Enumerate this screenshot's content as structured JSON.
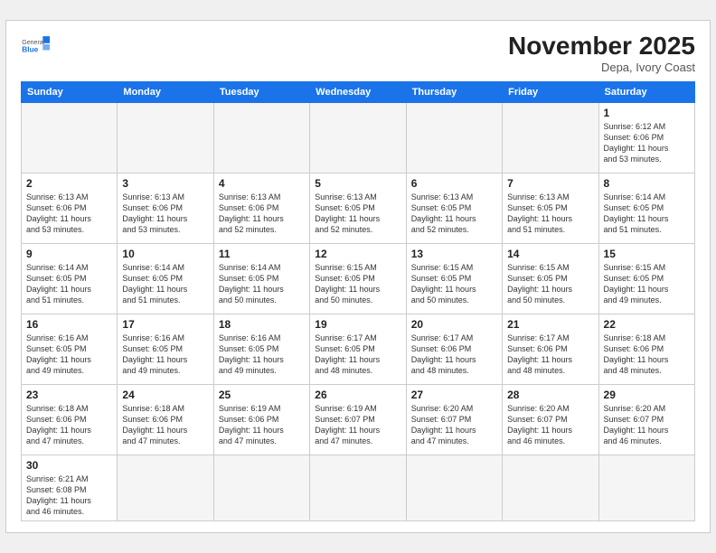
{
  "header": {
    "logo_general": "General",
    "logo_blue": "Blue",
    "month_title": "November 2025",
    "subtitle": "Depa, Ivory Coast"
  },
  "weekdays": [
    "Sunday",
    "Monday",
    "Tuesday",
    "Wednesday",
    "Thursday",
    "Friday",
    "Saturday"
  ],
  "days": [
    {
      "num": "",
      "info": "",
      "empty": true
    },
    {
      "num": "",
      "info": "",
      "empty": true
    },
    {
      "num": "",
      "info": "",
      "empty": true
    },
    {
      "num": "",
      "info": "",
      "empty": true
    },
    {
      "num": "",
      "info": "",
      "empty": true
    },
    {
      "num": "",
      "info": "",
      "empty": true
    },
    {
      "num": "1",
      "info": "Sunrise: 6:12 AM\nSunset: 6:06 PM\nDaylight: 11 hours\nand 53 minutes.",
      "empty": false
    },
    {
      "num": "2",
      "info": "Sunrise: 6:13 AM\nSunset: 6:06 PM\nDaylight: 11 hours\nand 53 minutes.",
      "empty": false
    },
    {
      "num": "3",
      "info": "Sunrise: 6:13 AM\nSunset: 6:06 PM\nDaylight: 11 hours\nand 53 minutes.",
      "empty": false
    },
    {
      "num": "4",
      "info": "Sunrise: 6:13 AM\nSunset: 6:06 PM\nDaylight: 11 hours\nand 52 minutes.",
      "empty": false
    },
    {
      "num": "5",
      "info": "Sunrise: 6:13 AM\nSunset: 6:05 PM\nDaylight: 11 hours\nand 52 minutes.",
      "empty": false
    },
    {
      "num": "6",
      "info": "Sunrise: 6:13 AM\nSunset: 6:05 PM\nDaylight: 11 hours\nand 52 minutes.",
      "empty": false
    },
    {
      "num": "7",
      "info": "Sunrise: 6:13 AM\nSunset: 6:05 PM\nDaylight: 11 hours\nand 51 minutes.",
      "empty": false
    },
    {
      "num": "8",
      "info": "Sunrise: 6:14 AM\nSunset: 6:05 PM\nDaylight: 11 hours\nand 51 minutes.",
      "empty": false
    },
    {
      "num": "9",
      "info": "Sunrise: 6:14 AM\nSunset: 6:05 PM\nDaylight: 11 hours\nand 51 minutes.",
      "empty": false
    },
    {
      "num": "10",
      "info": "Sunrise: 6:14 AM\nSunset: 6:05 PM\nDaylight: 11 hours\nand 51 minutes.",
      "empty": false
    },
    {
      "num": "11",
      "info": "Sunrise: 6:14 AM\nSunset: 6:05 PM\nDaylight: 11 hours\nand 50 minutes.",
      "empty": false
    },
    {
      "num": "12",
      "info": "Sunrise: 6:15 AM\nSunset: 6:05 PM\nDaylight: 11 hours\nand 50 minutes.",
      "empty": false
    },
    {
      "num": "13",
      "info": "Sunrise: 6:15 AM\nSunset: 6:05 PM\nDaylight: 11 hours\nand 50 minutes.",
      "empty": false
    },
    {
      "num": "14",
      "info": "Sunrise: 6:15 AM\nSunset: 6:05 PM\nDaylight: 11 hours\nand 50 minutes.",
      "empty": false
    },
    {
      "num": "15",
      "info": "Sunrise: 6:15 AM\nSunset: 6:05 PM\nDaylight: 11 hours\nand 49 minutes.",
      "empty": false
    },
    {
      "num": "16",
      "info": "Sunrise: 6:16 AM\nSunset: 6:05 PM\nDaylight: 11 hours\nand 49 minutes.",
      "empty": false
    },
    {
      "num": "17",
      "info": "Sunrise: 6:16 AM\nSunset: 6:05 PM\nDaylight: 11 hours\nand 49 minutes.",
      "empty": false
    },
    {
      "num": "18",
      "info": "Sunrise: 6:16 AM\nSunset: 6:05 PM\nDaylight: 11 hours\nand 49 minutes.",
      "empty": false
    },
    {
      "num": "19",
      "info": "Sunrise: 6:17 AM\nSunset: 6:05 PM\nDaylight: 11 hours\nand 48 minutes.",
      "empty": false
    },
    {
      "num": "20",
      "info": "Sunrise: 6:17 AM\nSunset: 6:06 PM\nDaylight: 11 hours\nand 48 minutes.",
      "empty": false
    },
    {
      "num": "21",
      "info": "Sunrise: 6:17 AM\nSunset: 6:06 PM\nDaylight: 11 hours\nand 48 minutes.",
      "empty": false
    },
    {
      "num": "22",
      "info": "Sunrise: 6:18 AM\nSunset: 6:06 PM\nDaylight: 11 hours\nand 48 minutes.",
      "empty": false
    },
    {
      "num": "23",
      "info": "Sunrise: 6:18 AM\nSunset: 6:06 PM\nDaylight: 11 hours\nand 47 minutes.",
      "empty": false
    },
    {
      "num": "24",
      "info": "Sunrise: 6:18 AM\nSunset: 6:06 PM\nDaylight: 11 hours\nand 47 minutes.",
      "empty": false
    },
    {
      "num": "25",
      "info": "Sunrise: 6:19 AM\nSunset: 6:06 PM\nDaylight: 11 hours\nand 47 minutes.",
      "empty": false
    },
    {
      "num": "26",
      "info": "Sunrise: 6:19 AM\nSunset: 6:07 PM\nDaylight: 11 hours\nand 47 minutes.",
      "empty": false
    },
    {
      "num": "27",
      "info": "Sunrise: 6:20 AM\nSunset: 6:07 PM\nDaylight: 11 hours\nand 47 minutes.",
      "empty": false
    },
    {
      "num": "28",
      "info": "Sunrise: 6:20 AM\nSunset: 6:07 PM\nDaylight: 11 hours\nand 46 minutes.",
      "empty": false
    },
    {
      "num": "29",
      "info": "Sunrise: 6:20 AM\nSunset: 6:07 PM\nDaylight: 11 hours\nand 46 minutes.",
      "empty": false
    },
    {
      "num": "30",
      "info": "Sunrise: 6:21 AM\nSunset: 6:08 PM\nDaylight: 11 hours\nand 46 minutes.",
      "empty": false
    },
    {
      "num": "",
      "info": "",
      "empty": true
    },
    {
      "num": "",
      "info": "",
      "empty": true
    },
    {
      "num": "",
      "info": "",
      "empty": true
    },
    {
      "num": "",
      "info": "",
      "empty": true
    },
    {
      "num": "",
      "info": "",
      "empty": true
    },
    {
      "num": "",
      "info": "",
      "empty": true
    }
  ]
}
